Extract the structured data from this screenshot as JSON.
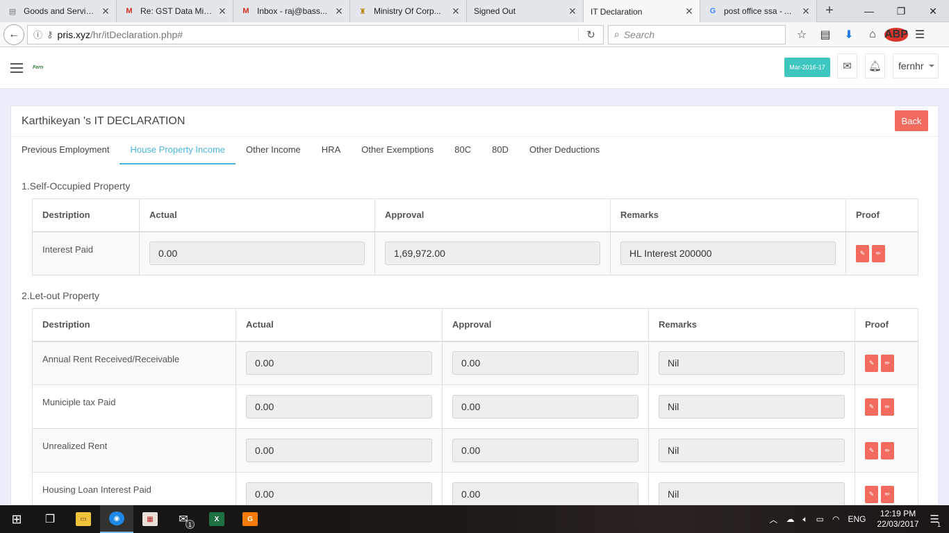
{
  "browser": {
    "tabs": [
      {
        "title": "Goods and Servic...",
        "icon": "document-icon"
      },
      {
        "title": "Re: GST Data Mig...",
        "icon": "gmail-icon"
      },
      {
        "title": "Inbox - raj@bass...",
        "icon": "gmail-icon"
      },
      {
        "title": "Ministry Of Corp...",
        "icon": "emblem-icon"
      },
      {
        "title": "Signed Out",
        "icon": ""
      },
      {
        "title": "IT Declaration",
        "icon": ""
      },
      {
        "title": "post office ssa - ...",
        "icon": "google-icon"
      }
    ],
    "url_host": "pris.xyz",
    "url_path": "/hr/itDeclaration.php#",
    "search_placeholder": "Search",
    "abp_label": "ABP"
  },
  "header": {
    "logo_text": "Fern",
    "period": "Mar-2016-17",
    "user": "fernhr"
  },
  "page": {
    "title": "Karthikeyan 's IT DECLARATION",
    "back_label": "Back",
    "tabs": [
      {
        "label": "Previous Employment",
        "active": false
      },
      {
        "label": "House Property Income",
        "active": true
      },
      {
        "label": "Other Income",
        "active": false
      },
      {
        "label": "HRA",
        "active": false
      },
      {
        "label": "Other Exemptions",
        "active": false
      },
      {
        "label": "80C",
        "active": false
      },
      {
        "label": "80D",
        "active": false
      },
      {
        "label": "Other Deductions",
        "active": false
      }
    ],
    "section1": {
      "title": "1.Self-Occupied Property",
      "headers": [
        "Destription",
        "Actual",
        "Approval",
        "Remarks",
        "Proof"
      ],
      "rows": [
        {
          "desc": "Interest Paid",
          "actual": "0.00",
          "approval": "1,69,972.00",
          "remarks": "HL Interest 200000"
        }
      ]
    },
    "section2": {
      "title": "2.Let-out Property",
      "headers": [
        "Destription",
        "Actual",
        "Approval",
        "Remarks",
        "Proof"
      ],
      "rows": [
        {
          "desc": "Annual Rent Received/Receivable",
          "actual": "0.00",
          "approval": "0.00",
          "remarks": "Nil"
        },
        {
          "desc": "Municiple tax Paid",
          "actual": "0.00",
          "approval": "0.00",
          "remarks": "Nil"
        },
        {
          "desc": "Unrealized Rent",
          "actual": "0.00",
          "approval": "0.00",
          "remarks": "Nil"
        },
        {
          "desc": "Housing Loan Interest Paid",
          "actual": "0.00",
          "approval": "0.00",
          "remarks": "Nil"
        }
      ]
    }
  },
  "taskbar": {
    "language": "ENG",
    "time": "12:19 PM",
    "date": "22/03/2017",
    "mail_badge": "1",
    "notif_badge": "1"
  },
  "colors": {
    "accent": "#4bb6db",
    "danger": "#f26b5e",
    "period_badge": "#3fc6c0",
    "page_bg": "#e9eef8"
  }
}
